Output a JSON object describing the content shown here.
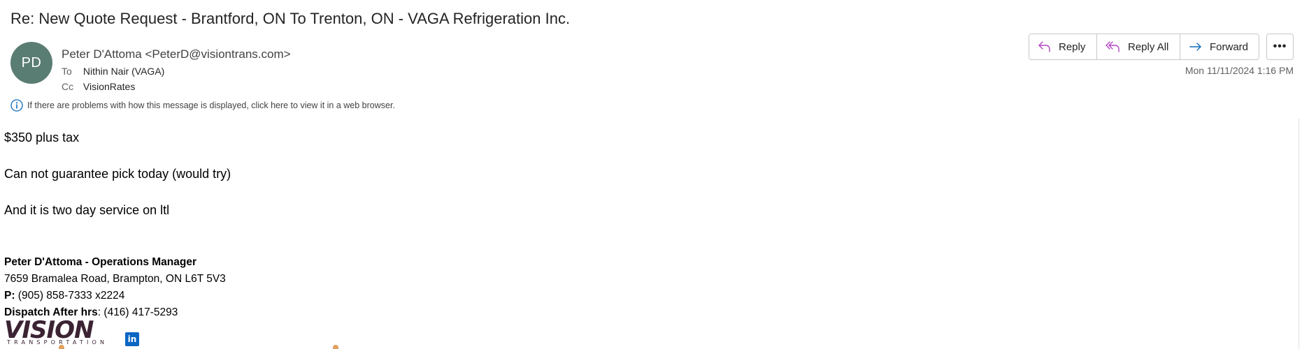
{
  "email": {
    "subject": "Re: New Quote Request - Brantford, ON To Trenton, ON - VAGA Refrigeration Inc.",
    "sender": {
      "initials": "PD",
      "display": "Peter D'Attoma <PeterD@visiontrans.com>",
      "avatar_color": "#5a7d73"
    },
    "to_label": "To",
    "to_value": "Nithin Nair (VAGA)",
    "cc_label": "Cc",
    "cc_value": "VisionRates",
    "date": "Mon 11/11/2024 1:16 PM",
    "info_notice": "If there are problems with how this message is displayed, click here to view it in a web browser."
  },
  "actions": {
    "reply_label": "Reply",
    "reply_all_label": "Reply All",
    "forward_label": "Forward",
    "more_label": "•••",
    "reply_color": "#b146c2",
    "forward_color": "#0f6cbd"
  },
  "body": {
    "line1": "$350 plus tax",
    "line2": "Can not guarantee pick today (would try)",
    "line3": "And it is two day service on ltl"
  },
  "signature": {
    "name_title": "Peter D'Attoma -  Operations Manager",
    "address": "7659 Bramalea Road, Brampton, ON  L6T 5V3",
    "phone_label": "P:",
    "phone_value": " (905) 858-7333 x2224",
    "afterhours_label": "Dispatch After hrs",
    "afterhours_value": ": (416) 417-5293",
    "logo_word": "VISION",
    "logo_sub": "TRANSPORTATION",
    "linkedin_text": "in"
  }
}
